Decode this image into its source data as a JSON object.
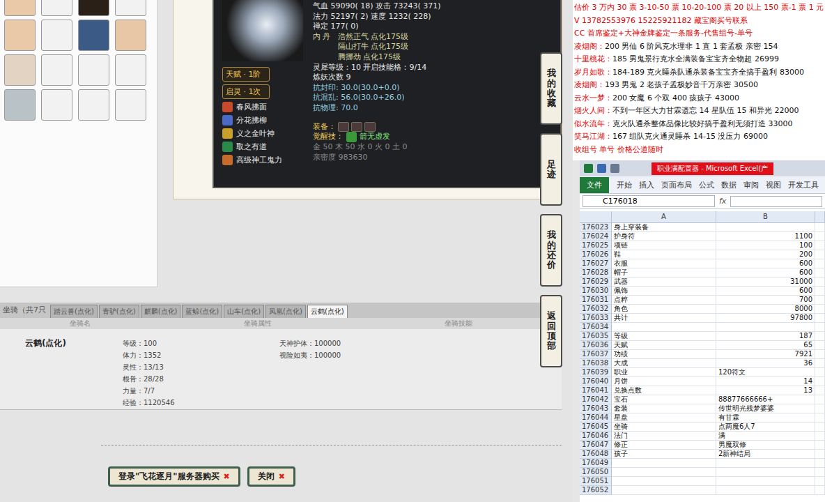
{
  "pet": {
    "badges": [
      "天赋 · 1阶",
      "启灵 · 1次"
    ],
    "skills": [
      "春风拂面",
      "分花拂柳",
      "义之金叶神",
      "取之有道",
      "高级神工鬼力"
    ],
    "stats": [
      {
        "text": "气血 59090( 18) 攻击 73243( 371)",
        "kind": "stat"
      },
      {
        "text": "法力 52197( 2) 速度 1232( 228)",
        "kind": "stat"
      },
      {
        "text": "禅定 177( 0)",
        "kind": "stat"
      }
    ],
    "neidan": {
      "label": "内  丹",
      "items": [
        "浩然正气 点化175级",
        "隔山打牛 点化175级",
        "腾挪劲 点化175级"
      ]
    },
    "details": [
      {
        "text": "灵犀等级：10 开启技能格：9/14",
        "kind": "meta"
      },
      {
        "text": "炼妖次数 9",
        "kind": "meta"
      },
      {
        "text": "抗封印: 30.0(30.0+0.0)",
        "kind": "resist"
      },
      {
        "text": "抗混乱: 56.0(30.0+26.0)",
        "kind": "resist"
      },
      {
        "text": "抗物理: 70.0",
        "kind": "resist"
      }
    ],
    "equipment_label": "装备：",
    "awaken_label": "觉醒技：",
    "awaken_value": "箭无虚发",
    "elements": "金 50 木 50 水 0 火 0 土 0",
    "intimacy": "亲密度 983630"
  },
  "side_nav": [
    "我的收藏",
    "足迹",
    "我的还价",
    "返回顶部"
  ],
  "mounts": {
    "label": "坐骑（共7只",
    "tabs": [
      {
        "label": "踏云兽(点化)",
        "selected": false
      },
      {
        "label": "青驴(点化)",
        "selected": false
      },
      {
        "label": "麒麟(点化)",
        "selected": false
      },
      {
        "label": "蓝鲸(点化)",
        "selected": false
      },
      {
        "label": "山车(点化)",
        "selected": false
      },
      {
        "label": "凤凰(点化)",
        "selected": false
      },
      {
        "label": "云鹤(点化)",
        "selected": true
      }
    ],
    "columns": [
      "坐骑名",
      "坐骑属性",
      "坐骑技能"
    ],
    "row": {
      "name": "云鹤(点化)",
      "attributes": [
        "等级：100",
        "体力：1352",
        "灵性：13/13",
        "根骨：28/28",
        "力量：7/7",
        "经验：1120546"
      ],
      "skills": [
        "天神护体：100000",
        "视险如夷：100000"
      ]
    }
  },
  "actions": [
    "登录\"飞花逐月\"服务器购买",
    "关闭"
  ],
  "notes": [
    {
      "kind": "notice",
      "seller": "",
      "text": "估价 3 万内 30 票 3-10-50 票 10-20-100 票 20 以上 150 票-1 票 1 元"
    },
    {
      "kind": "notice",
      "seller": "",
      "text": "V 13782553976   15225921182   藏宝阁买号联系"
    },
    {
      "kind": "notice",
      "seller": "",
      "text": "CC 首席鉴定+大神金牌鉴定一条服务-代售组号-单号"
    },
    {
      "kind": "listing",
      "seller": "凌烟阁：",
      "text": "200 男仙 6 阶风克水理非 1 直 1 套孟极 亲密 154"
    },
    {
      "kind": "listing",
      "seller": "十里桃花：",
      "text": "185 男鬼景行克水全满装备宝宝齐全物超 26999"
    },
    {
      "kind": "listing",
      "seller": "岁月如歌：",
      "text": "184-189 克火睡杀队通杀装备宝宝齐全搞手盈利 83000"
    },
    {
      "kind": "listing",
      "seller": "凌烟阁：",
      "text": "193 男鬼 2 老孩子孟极妙音千万亲密 30500"
    },
    {
      "kind": "listing",
      "seller": "云水一梦：",
      "text": "200 女魔 6 个双 400 孩孩子 43000"
    },
    {
      "kind": "listing",
      "seller": "烟火人间：",
      "text": "不到一年区大力甘霖遗忘 14 星队伍 15 和异光 22000"
    },
    {
      "kind": "listing",
      "seller": "似水流年：",
      "text": "克火队通杀整体品像比较好搞手盈利无须打造 33000"
    },
    {
      "kind": "listing",
      "seller": "笑马江湖：",
      "text": "167 组队克火通灵睡杀 14-15 没压力 69000"
    },
    {
      "kind": "notice",
      "seller": "",
      "text": "收组号 单号 价格公道随时"
    }
  ],
  "excel": {
    "title": "职业满配置器 - Microsoft Excel(产",
    "file_tab": "文件",
    "ribbon_tabs": [
      "开始",
      "插入",
      "页面布局",
      "公式",
      "数据",
      "审阅",
      "视图",
      "开发工具"
    ],
    "name_box": "C176018",
    "fx": "fx",
    "columns": [
      "A",
      "B"
    ],
    "rows": [
      {
        "num": "176023",
        "a": "身上穿装备",
        "b": ""
      },
      {
        "num": "176024",
        "a": "护身符",
        "b": "1100"
      },
      {
        "num": "176025",
        "a": "项链",
        "b": "100"
      },
      {
        "num": "176026",
        "a": "鞋",
        "b": "200"
      },
      {
        "num": "176027",
        "a": "衣服",
        "b": "600"
      },
      {
        "num": "176028",
        "a": "帽子",
        "b": "600"
      },
      {
        "num": "176029",
        "a": "武器",
        "b": "31000"
      },
      {
        "num": "176030",
        "a": "佩饰",
        "b": "600"
      },
      {
        "num": "176031",
        "a": "点粹",
        "b": "700"
      },
      {
        "num": "176032",
        "a": "角色",
        "b": "8000"
      },
      {
        "num": "176033",
        "a": "共计",
        "b": "97800"
      },
      {
        "num": "176034",
        "a": "",
        "b": ""
      },
      {
        "num": "176035",
        "a": "等级",
        "b": "187"
      },
      {
        "num": "176036",
        "a": "天赋",
        "b": "65"
      },
      {
        "num": "176037",
        "a": "功绩",
        "b": "7921"
      },
      {
        "num": "176038",
        "a": "大成",
        "b": "36"
      },
      {
        "num": "176039",
        "a": "职业",
        "b": "120符文"
      },
      {
        "num": "176040",
        "a": "月饼",
        "b": "14"
      },
      {
        "num": "176041",
        "a": "兑换点数",
        "b": "13"
      },
      {
        "num": "176042",
        "a": "宝石",
        "b": "88877666666+"
      },
      {
        "num": "176043",
        "a": "套装",
        "b": "传世明光残梦婆婆"
      },
      {
        "num": "176044",
        "a": "星盘",
        "b": "有甘霖"
      },
      {
        "num": "176045",
        "a": "坐骑",
        "b": "点两魔6人7"
      },
      {
        "num": "176046",
        "a": "法门",
        "b": "满"
      },
      {
        "num": "176047",
        "a": "修正",
        "b": "男魔双修"
      },
      {
        "num": "176048",
        "a": "孩子",
        "b": "2新神结局"
      },
      {
        "num": "176049",
        "a": "",
        "b": ""
      },
      {
        "num": "176050",
        "a": "",
        "b": ""
      },
      {
        "num": "176051",
        "a": "",
        "b": ""
      },
      {
        "num": "176052",
        "a": "",
        "b": ""
      }
    ]
  }
}
